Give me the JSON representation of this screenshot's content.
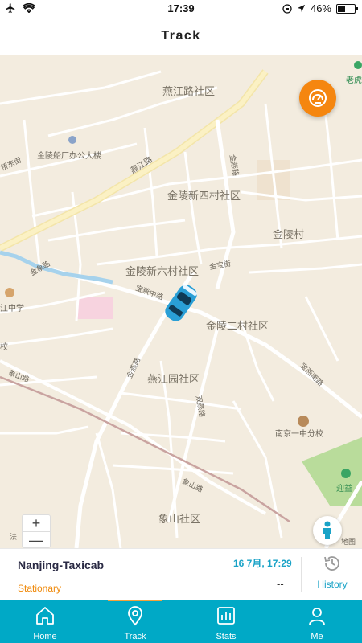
{
  "status_bar": {
    "time": "17:39",
    "battery": "46%",
    "battery_level": 0.46
  },
  "header": {
    "title": "Track"
  },
  "map": {
    "labels": {
      "yanjianglu_community": "燕江路社区",
      "jinling_shipyard": "金陵船厂办公大楼",
      "yanjiang_road": "燕江路",
      "jinling_new4": "金陵新四村社区",
      "jinlingcun": "金陵村",
      "jinling_new6": "金陵新六村社区",
      "jinling_er": "金陵二村社区",
      "yanjiangyuan": "燕江园社区",
      "nanjing_no1_branch": "南京一中分校",
      "xiangshan_community": "象山社区",
      "jiangzhong": "江中学",
      "xiao": "校",
      "laohu": "老虎",
      "yingyi": "迎益",
      "baoshao_road": "宝燕中路",
      "jinbao_street": "金宝街",
      "jinyan_road": "金燕路",
      "jinxiang_road": "金象路",
      "xiangshan_road": "象山路",
      "shuangyan_road": "双燕路",
      "xiangshan_road2": "象山路",
      "qiaobei": "桥东街",
      "baoyan_south": "宝燕南路",
      "jinyan_road2": "金燕路",
      "fa": "法",
      "baidu_map": "地图"
    },
    "zoom_in": "+",
    "zoom_out": "—"
  },
  "vehicle": {
    "name": "Nanjing-Taxicab",
    "status": "Stationary",
    "time": "16 7月, 17:29",
    "speed": "--"
  },
  "history": {
    "label": "History"
  },
  "tabs": [
    {
      "label": "Home",
      "icon": "home-icon"
    },
    {
      "label": "Track",
      "icon": "location-pin-icon"
    },
    {
      "label": "Stats",
      "icon": "stats-icon"
    },
    {
      "label": "Me",
      "icon": "user-icon"
    }
  ],
  "colors": {
    "accent": "#00a9c6",
    "orange": "#f5860f",
    "status_orange": "#f08a0c"
  }
}
